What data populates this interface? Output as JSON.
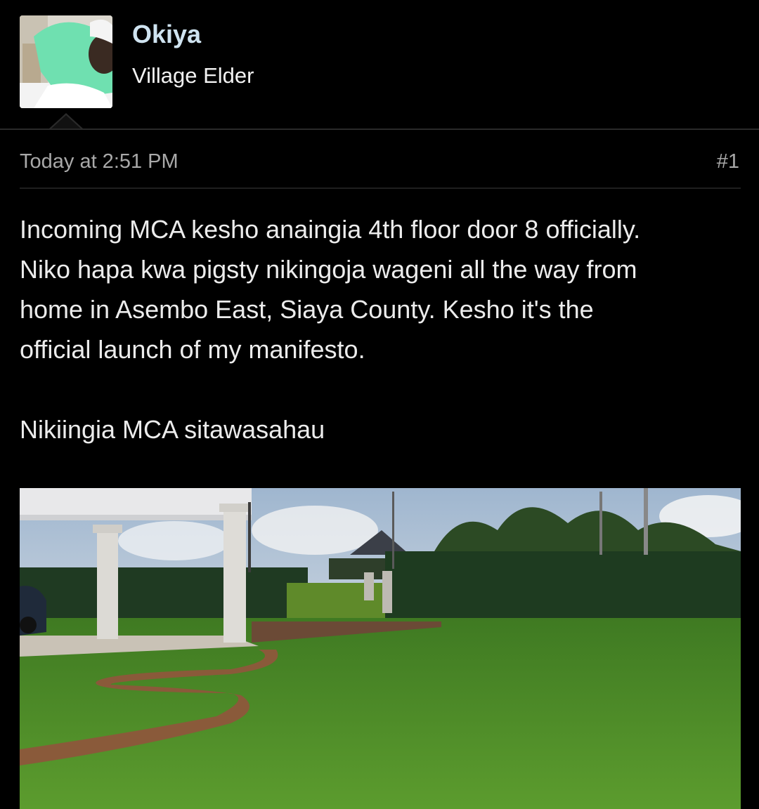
{
  "post": {
    "author": {
      "name": "Okiya",
      "title": "Village Elder"
    },
    "timestamp": "Today at 2:51 PM",
    "post_number": "#1",
    "paragraphs": [
      "Incoming MCA kesho anaingia 4th floor door 8 officially.",
      "Niko hapa kwa pigsty nikingoja wageni all the way from",
      "home in Asembo East, Siaya County. Kesho it's the",
      "official launch of my manifesto."
    ],
    "closing_line": "Nikiingia MCA sitawasahau"
  },
  "colors": {
    "background": "#000000",
    "username": "#cfe3f0",
    "body_text": "#ececec",
    "meta_text": "#a9a9a9"
  }
}
